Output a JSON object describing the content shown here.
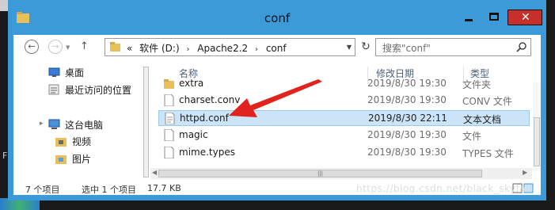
{
  "window": {
    "title": "conf",
    "controls": [
      "minimize",
      "maximize",
      "close"
    ],
    "close_glyph": "✕"
  },
  "navigation": {
    "back_glyph": "←",
    "forward_glyph": "→",
    "breadcrumb": {
      "overflow": "«",
      "parts": [
        "软件 (D:)",
        "Apache2.2",
        "conf"
      ],
      "separator": "›"
    },
    "search_placeholder": "搜索\"conf\""
  },
  "navpane": {
    "items": [
      {
        "label": "桌面",
        "icon": "desktop-icon"
      },
      {
        "label": "最近访问的位置",
        "icon": "recent-places-icon"
      },
      {
        "label": "这台电脑",
        "icon": "computer-icon"
      },
      {
        "label": "视频",
        "icon": "videos-folder-icon"
      },
      {
        "label": "图片",
        "icon": "pictures-folder-icon"
      }
    ]
  },
  "filelist": {
    "columns": [
      "名称",
      "修改日期",
      "类型"
    ],
    "rows": [
      {
        "name": "extra",
        "date": "2019/8/30 19:30",
        "type": "文件夹",
        "icon": "folder-icon",
        "selected": false
      },
      {
        "name": "charset.conv",
        "date": "2019/8/30 19:30",
        "type": "CONV 文件",
        "icon": "file-icon",
        "selected": false
      },
      {
        "name": "httpd.conf",
        "date": "2019/8/30 22:11",
        "type": "文本文档",
        "icon": "text-file-icon",
        "selected": true
      },
      {
        "name": "magic",
        "date": "2019/8/30 19:30",
        "type": "文件",
        "icon": "file-icon",
        "selected": false
      },
      {
        "name": "mime.types",
        "date": "2019/8/30 19:30",
        "type": "TYPES 文件",
        "icon": "file-icon",
        "selected": false
      }
    ]
  },
  "status": {
    "item_count": "7 个项目",
    "selected": "选中 1 个项目",
    "size": "17.7 KB"
  },
  "watermark": "https://blog.csdn.net/black_skyfall",
  "desktop_fragment": "F",
  "colors": {
    "title_bar": "#3c9ad8",
    "close_button": "#c7302a",
    "selection": "#cce4f7",
    "arrow": "#e0231c",
    "folder": "#e8c05a"
  }
}
